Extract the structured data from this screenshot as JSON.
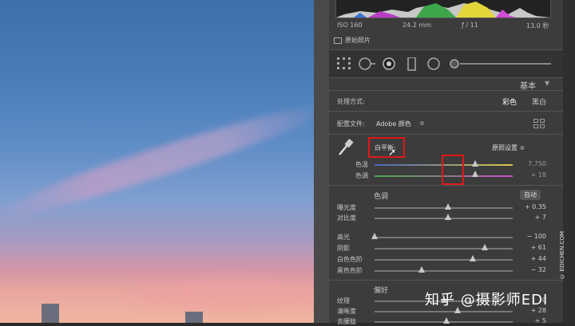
{
  "meta": {
    "iso": "ISO 160",
    "focal": "24.2 mm",
    "aperture": "ƒ / 11",
    "shutter": "13.0 秒"
  },
  "original_photo_label": "原始照片",
  "panel_title": "基本",
  "treatment": {
    "label": "处理方式:",
    "color": "彩色",
    "bw": "黑白"
  },
  "profile": {
    "label": "配置文件:",
    "value": "Adobe 颜色",
    "arrow": "≑"
  },
  "white_balance": {
    "label": "白平衡:",
    "preset": "原照设置 ≑",
    "temp": {
      "label": "色温",
      "value": "7,750",
      "position": 0.73
    },
    "tint": {
      "label": "色调",
      "value": "+ 18",
      "position": 0.73
    }
  },
  "tone": {
    "title": "色调",
    "auto": "自动",
    "sliders": [
      {
        "label": "曝光度",
        "value": "+ 0.35",
        "position": 0.53
      },
      {
        "label": "对比度",
        "value": "+ 7",
        "position": 0.53
      },
      {
        "label": "高光",
        "value": "− 100",
        "position": 0.0
      },
      {
        "label": "阴影",
        "value": "+ 61",
        "position": 0.8
      },
      {
        "label": "白色色阶",
        "value": "+ 44",
        "position": 0.71
      },
      {
        "label": "黑色色阶",
        "value": "− 32",
        "position": 0.34
      }
    ]
  },
  "presence": {
    "title": "偏好",
    "sliders": [
      {
        "label": "纹理",
        "value": "0",
        "position": 0.5
      },
      {
        "label": "清晰度",
        "value": "+ 28",
        "position": 0.6
      },
      {
        "label": "去朦胧",
        "value": "+ 5",
        "position": 0.52
      }
    ]
  },
  "watermark": "知乎 @摄影师EDI",
  "side_credit": "© EDICHEN.COM",
  "colors": {
    "highlight_box": "#e01818",
    "panel_bg": "#3c3c3c"
  }
}
